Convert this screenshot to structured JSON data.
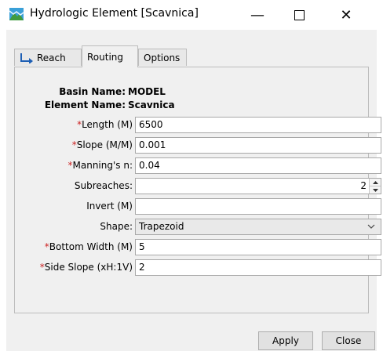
{
  "window": {
    "title": "Hydrologic Element [Scavnica]",
    "icon": "hydrologic-element-app-icon",
    "minimize_glyph": "—",
    "close_glyph": "✕"
  },
  "tabs": [
    {
      "label": "Reach",
      "icon": "reach-icon",
      "active": false
    },
    {
      "label": "Routing",
      "active": true
    },
    {
      "label": "Options",
      "active": false
    }
  ],
  "info": {
    "basin_label": "Basin Name:",
    "basin_value": "MODEL",
    "element_label": "Element Name:",
    "element_value": "Scavnica"
  },
  "fields": {
    "length": {
      "required": "*",
      "label": "Length (M)",
      "value": "6500"
    },
    "slope": {
      "required": "*",
      "label": "Slope (M/M)",
      "value": "0.001"
    },
    "manning": {
      "required": "*",
      "label": "Manning's n:",
      "value": "0.04"
    },
    "subreaches": {
      "label": "Subreaches:",
      "value": "2"
    },
    "invert": {
      "label": "Invert (M)",
      "value": ""
    },
    "shape": {
      "label": "Shape:",
      "value": "Trapezoid"
    },
    "bottom_width": {
      "required": "*",
      "label": "Bottom Width (M)",
      "value": "5"
    },
    "side_slope": {
      "required": "*",
      "label": "Side Slope (xH:1V)",
      "value": "2"
    }
  },
  "buttons": {
    "apply": "Apply",
    "close": "Close"
  },
  "colors": {
    "required_marker": "#cc2222",
    "panel_bg": "#f0f0f0"
  }
}
